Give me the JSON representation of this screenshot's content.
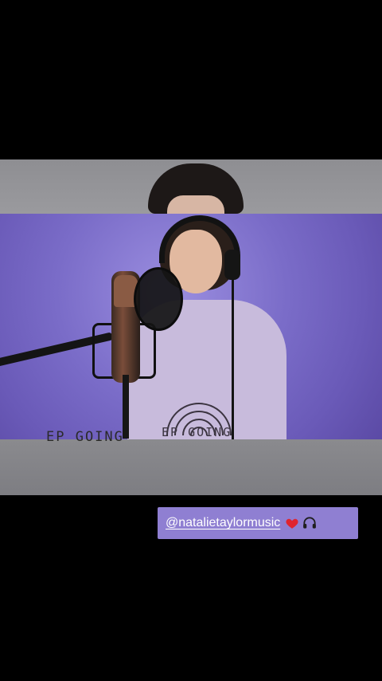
{
  "story": {
    "shirt_text": "EP GOING",
    "shirt_text_lower": "EP GOING",
    "mention_sticker": {
      "handle": "@natalietaylormusic",
      "icons": [
        "heart-icon",
        "headphones-icon"
      ]
    }
  }
}
